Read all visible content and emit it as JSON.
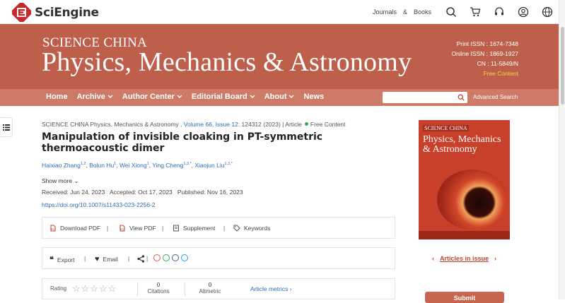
{
  "header": {
    "brand": "SciEngine",
    "links": [
      "Journals",
      "&",
      "Books"
    ],
    "icons": [
      "search-icon",
      "cart-icon",
      "headset-icon",
      "user-icon",
      "globe-icon"
    ]
  },
  "banner": {
    "series": "SCIENCE CHINA",
    "journal": "Physics, Mechanics & Astronomy",
    "print_issn": "Print ISSN : 1674-7348",
    "online_issn": "Online ISSN : 1869-1927",
    "cn": "CN : 11-5849/N",
    "free_content": "Free Content"
  },
  "nav": {
    "items": [
      {
        "label": "Home",
        "dropdown": false
      },
      {
        "label": "Archive",
        "dropdown": true
      },
      {
        "label": "Author Center",
        "dropdown": true
      },
      {
        "label": "Editorial Board",
        "dropdown": true
      },
      {
        "label": "About",
        "dropdown": true
      },
      {
        "label": "News",
        "dropdown": false
      }
    ],
    "search_placeholder": "",
    "advanced_search": "Advanced Search"
  },
  "article": {
    "journal_name": "SCIENCE CHINA Physics, Mechanics & Astronomy",
    "sep1": " , ",
    "volume_issue": "Volume 66, Issue 12:",
    "article_no": " 124312 (2023) | Article",
    "access": "Free Content",
    "title": "Manipulation of invisible cloaking in PT-symmetric thermoacoustic dimer",
    "authors": [
      {
        "name": "Haixiao Zhang",
        "sup": "1,2"
      },
      {
        "name": "Bolun Hu",
        "sup": "1"
      },
      {
        "name": "Wei Xiong",
        "sup": "1"
      },
      {
        "name": "Ying Cheng",
        "sup": "1,3,*"
      },
      {
        "name": "Xiaojun Liu",
        "sup": "1,3,*"
      }
    ],
    "show_more": "Show more",
    "received": "Received: Jun 24, 2023",
    "accepted": "Accepted: Oct 17, 2023",
    "published": "Published: Nov 16, 2023",
    "doi": "https://doi.org/10.1007/s11433-023-2256-2"
  },
  "actions": {
    "download_pdf": "Download PDF",
    "view_pdf": "View PDF",
    "supplement": "Supplement",
    "keywords": "Keywords",
    "export": "Export",
    "email": "Email",
    "divider": "|"
  },
  "metrics": {
    "rating_label": "Rating",
    "stars": "☆☆☆☆☆",
    "citations_count": "0",
    "citations_label": "Citations",
    "altmetric_count": "0",
    "altmetric_label": "Altmetric",
    "article_metrics": "Article metrics"
  },
  "cover": {
    "series": "SCIENCE CHINA",
    "journal": "Physics, Mechanics & Astronomy"
  },
  "sidebar": {
    "articles_in_issue": "Articles in issue",
    "submit": "Submit"
  }
}
